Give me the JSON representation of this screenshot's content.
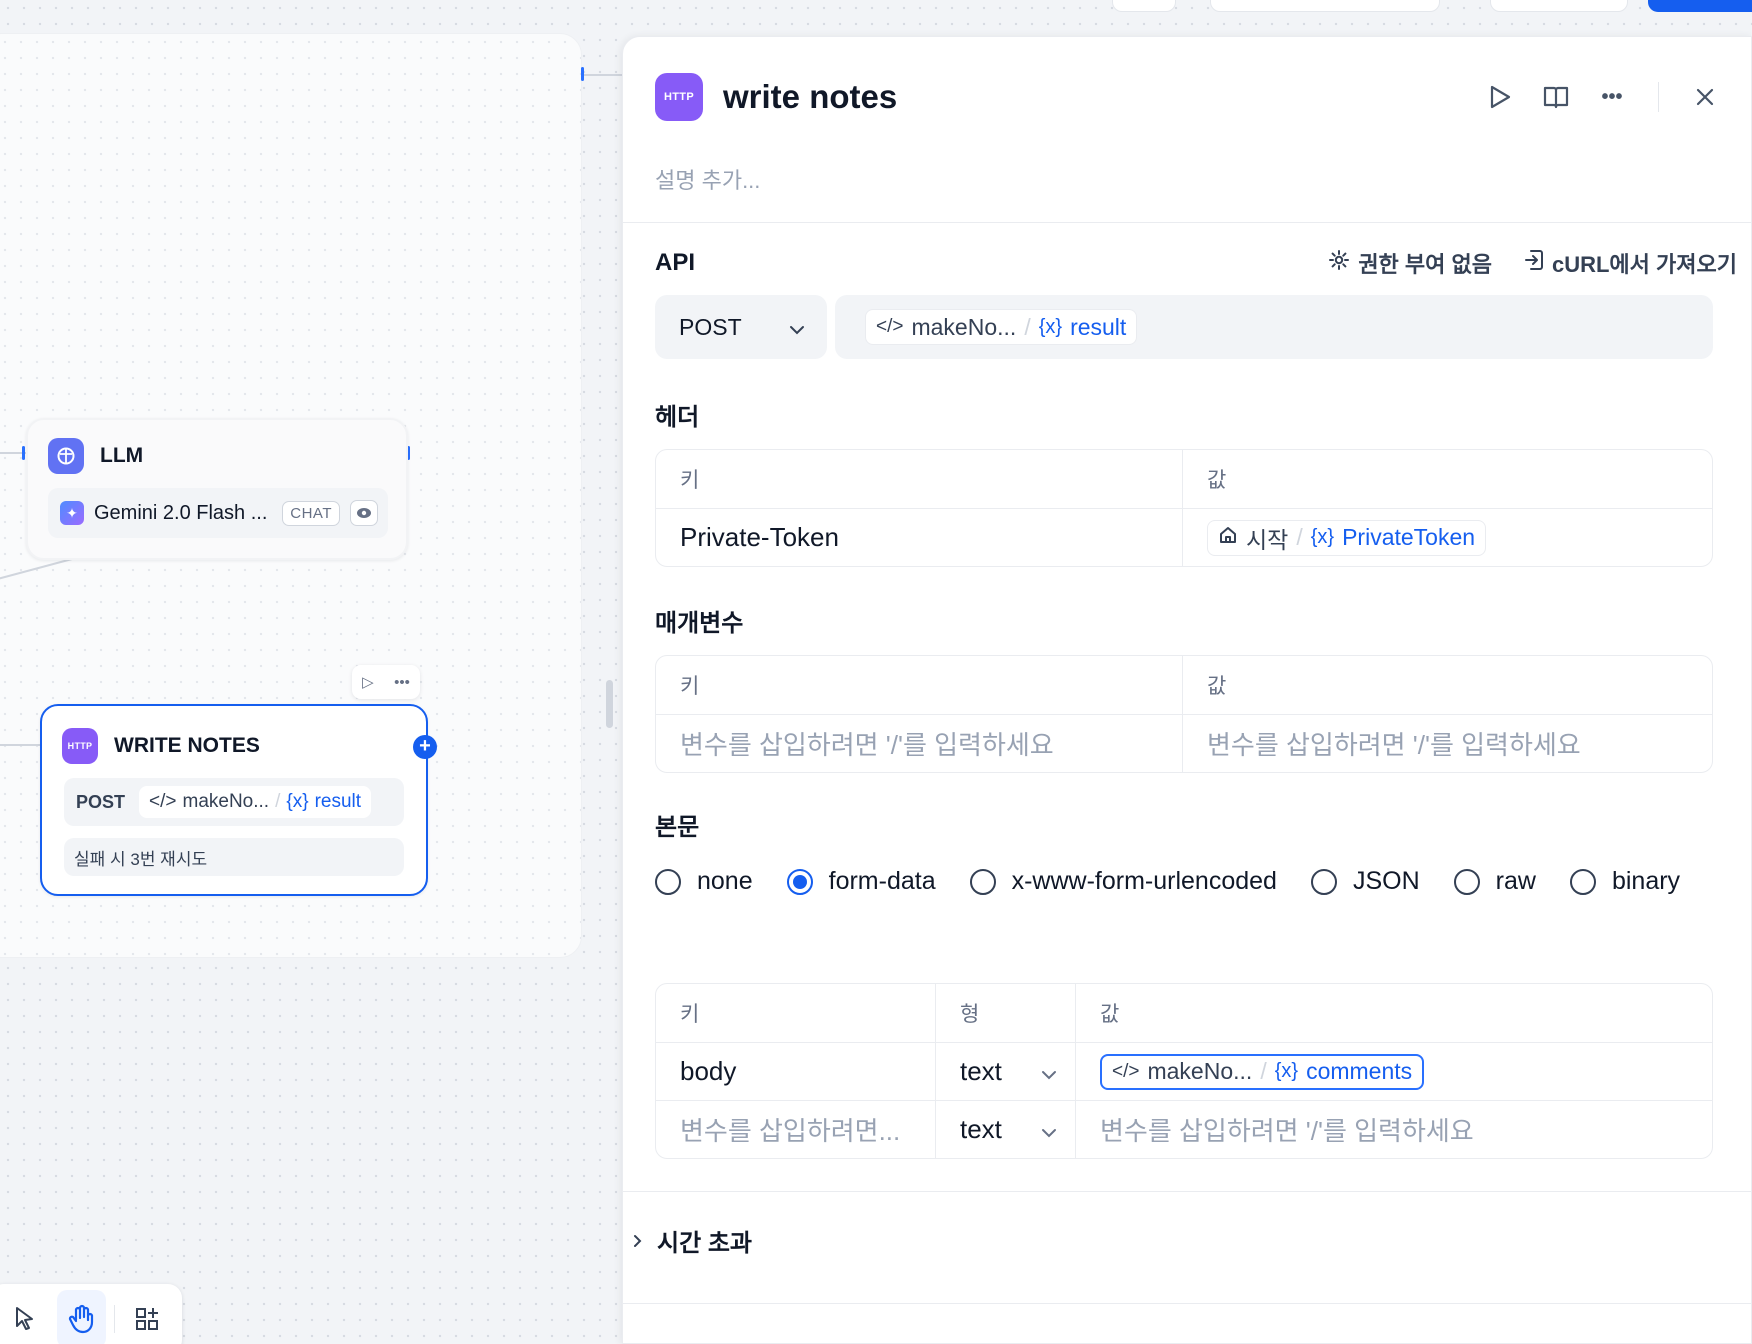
{
  "llm_node": {
    "title": "LLM",
    "model_name": "Gemini 2.0 Flash ...",
    "mode_badge": "CHAT"
  },
  "write_node": {
    "icon_label": "HTTP",
    "title": "WRITE NOTES",
    "method": "POST",
    "url_node": "makeNo...",
    "url_var": "result",
    "retry_text": "실패 시 3번 재시도"
  },
  "panel": {
    "icon_label": "HTTP",
    "title": "write notes",
    "description_placeholder": "설명 추가...",
    "api": {
      "label": "API",
      "auth_link": "권한 부여 없음",
      "curl_link": "cURL에서 가져오기",
      "method": "POST",
      "url_node": "makeNo...",
      "url_var": "result"
    },
    "headers": {
      "label": "헤더",
      "col_key": "키",
      "col_value": "값",
      "rows": [
        {
          "key": "Private-Token",
          "value_node": "시작",
          "value_var": "PrivateToken"
        }
      ]
    },
    "params": {
      "label": "매개변수",
      "col_key": "키",
      "col_value": "값",
      "key_placeholder": "변수를 삽입하려면 '/'를 입력하세요",
      "value_placeholder": "변수를 삽입하려면 '/'를 입력하세요"
    },
    "body": {
      "label": "본문",
      "types": [
        "none",
        "form-data",
        "x-www-form-urlencoded",
        "JSON",
        "raw",
        "binary"
      ],
      "selected_type": "form-data",
      "col_key": "키",
      "col_type": "형",
      "col_value": "값",
      "rows": [
        {
          "key": "body",
          "type": "text",
          "value_node": "makeNo...",
          "value_var": "comments"
        }
      ],
      "empty_key_placeholder": "변수를 삽입하려면...",
      "empty_type": "text",
      "empty_value_placeholder": "변수를 삽입하려면 '/'를 입력하세요"
    },
    "timeout_label": "시간 초과"
  },
  "colors": {
    "accent": "#155eef",
    "http_icon": "#875bf7",
    "llm_icon": "#6172f3"
  }
}
